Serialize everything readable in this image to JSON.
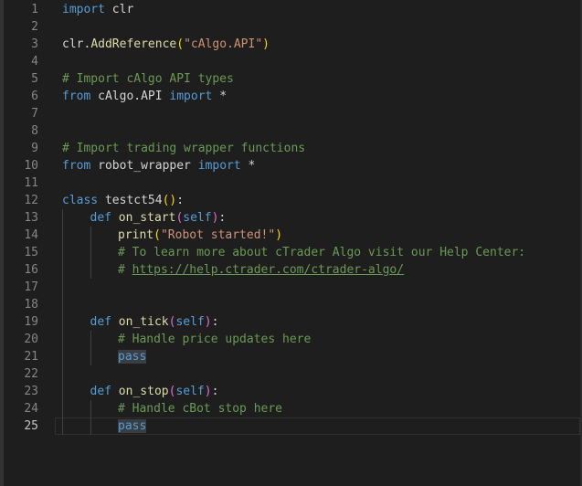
{
  "editor": {
    "current_line": 25,
    "lines": [
      {
        "num": "1",
        "tokens": [
          {
            "t": "import",
            "c": "kw"
          },
          {
            "t": " clr",
            "c": "plain"
          }
        ]
      },
      {
        "num": "2",
        "tokens": []
      },
      {
        "num": "3",
        "tokens": [
          {
            "t": "clr.",
            "c": "plain"
          },
          {
            "t": "AddReference",
            "c": "fn"
          },
          {
            "t": "(",
            "c": "paren"
          },
          {
            "t": "\"cAlgo.API\"",
            "c": "str"
          },
          {
            "t": ")",
            "c": "paren"
          }
        ]
      },
      {
        "num": "4",
        "tokens": []
      },
      {
        "num": "5",
        "tokens": [
          {
            "t": "# Import cAlgo API types",
            "c": "cmt"
          }
        ]
      },
      {
        "num": "6",
        "tokens": [
          {
            "t": "from",
            "c": "kw"
          },
          {
            "t": " cAlgo.API ",
            "c": "plain"
          },
          {
            "t": "import",
            "c": "kw"
          },
          {
            "t": " *",
            "c": "plain"
          }
        ]
      },
      {
        "num": "7",
        "tokens": []
      },
      {
        "num": "8",
        "tokens": []
      },
      {
        "num": "9",
        "tokens": [
          {
            "t": "# Import trading wrapper functions",
            "c": "cmt"
          }
        ]
      },
      {
        "num": "10",
        "tokens": [
          {
            "t": "from",
            "c": "kw"
          },
          {
            "t": " robot_wrapper ",
            "c": "plain"
          },
          {
            "t": "import",
            "c": "kw"
          },
          {
            "t": " *",
            "c": "plain"
          }
        ]
      },
      {
        "num": "11",
        "tokens": []
      },
      {
        "num": "12",
        "tokens": [
          {
            "t": "class",
            "c": "kw"
          },
          {
            "t": " testct54",
            "c": "plain"
          },
          {
            "t": "()",
            "c": "paren"
          },
          {
            "t": ":",
            "c": "plain"
          }
        ]
      },
      {
        "num": "13",
        "indent": 1,
        "tokens": [
          {
            "t": "def",
            "c": "kw"
          },
          {
            "t": " on_start",
            "c": "fn"
          },
          {
            "t": "(",
            "c": "paren2"
          },
          {
            "t": "self",
            "c": "self"
          },
          {
            "t": ")",
            "c": "paren2"
          },
          {
            "t": ":",
            "c": "plain"
          }
        ]
      },
      {
        "num": "14",
        "indent": 2,
        "tokens": [
          {
            "t": "print",
            "c": "fn"
          },
          {
            "t": "(",
            "c": "paren"
          },
          {
            "t": "\"Robot started!\"",
            "c": "str"
          },
          {
            "t": ")",
            "c": "paren"
          }
        ]
      },
      {
        "num": "15",
        "indent": 2,
        "tokens": [
          {
            "t": "# To learn more about cTrader Algo visit our Help Center:",
            "c": "cmt"
          }
        ]
      },
      {
        "num": "16",
        "indent": 2,
        "tokens": [
          {
            "t": "# ",
            "c": "cmt"
          },
          {
            "t": "https://help.ctrader.com/ctrader-algo/",
            "c": "link"
          }
        ]
      },
      {
        "num": "17",
        "indent": 1,
        "tokens": []
      },
      {
        "num": "18",
        "indent": 1,
        "tokens": []
      },
      {
        "num": "19",
        "indent": 1,
        "tokens": [
          {
            "t": "def",
            "c": "kw"
          },
          {
            "t": " on_tick",
            "c": "fn"
          },
          {
            "t": "(",
            "c": "paren2"
          },
          {
            "t": "self",
            "c": "self"
          },
          {
            "t": ")",
            "c": "paren2"
          },
          {
            "t": ":",
            "c": "plain"
          }
        ]
      },
      {
        "num": "20",
        "indent": 2,
        "tokens": [
          {
            "t": "# Handle price updates here",
            "c": "cmt"
          }
        ]
      },
      {
        "num": "21",
        "indent": 2,
        "tokens": [
          {
            "t": "pass",
            "c": "kw hl"
          }
        ]
      },
      {
        "num": "22",
        "indent": 1,
        "tokens": []
      },
      {
        "num": "23",
        "indent": 1,
        "tokens": [
          {
            "t": "def",
            "c": "kw"
          },
          {
            "t": " on_stop",
            "c": "fn"
          },
          {
            "t": "(",
            "c": "paren2"
          },
          {
            "t": "self",
            "c": "self"
          },
          {
            "t": ")",
            "c": "paren2"
          },
          {
            "t": ":",
            "c": "plain"
          }
        ]
      },
      {
        "num": "24",
        "indent": 2,
        "tokens": [
          {
            "t": "# Handle cBot stop here",
            "c": "cmt"
          }
        ]
      },
      {
        "num": "25",
        "indent": 2,
        "tokens": [
          {
            "t": "pass",
            "c": "kw hl"
          }
        ]
      }
    ]
  }
}
